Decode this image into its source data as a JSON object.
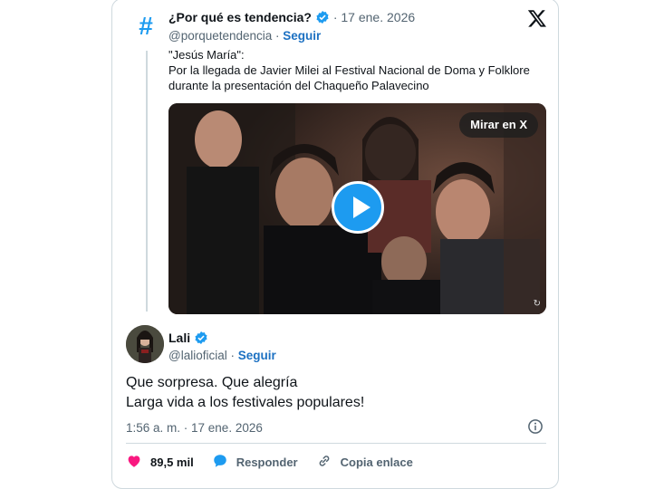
{
  "quoted": {
    "name": "¿Por qué es tendencia?",
    "date": "17 ene. 2026",
    "handle": "@porquetendencia",
    "follow_label": "Seguir",
    "text_lines": [
      "\"Jesús María\":",
      "Por la llegada de Javier Milei al Festival Nacional de Doma y Folklore",
      "durante la presentación del Chaqueño Palavecino"
    ],
    "media": {
      "watch_label": "Mirar en X"
    }
  },
  "post": {
    "name": "Lali",
    "handle": "@lalioficial",
    "follow_label": "Seguir",
    "text_lines": [
      "Que sorpresa. Que alegría",
      "Larga vida a los festivales populares!"
    ],
    "timestamp": "1:56 a. m. · 17 ene. 2026"
  },
  "actions": {
    "likes": "89,5 mil",
    "reply_label": "Responder",
    "copy_label": "Copia enlace"
  },
  "icons": {
    "brand": "x-logo-icon",
    "verified": "verified-badge-icon",
    "info": "info-icon",
    "heart": "heart-icon",
    "reply": "reply-bubble-icon",
    "link": "link-icon"
  },
  "colors": {
    "accent": "#1d9bf0",
    "heart": "#f91880",
    "text": "#0f1419",
    "muted": "#536471"
  }
}
